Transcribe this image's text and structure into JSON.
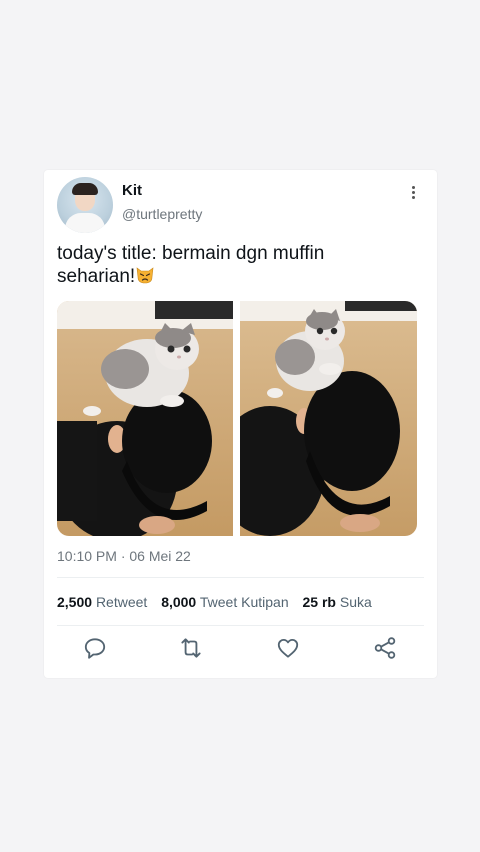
{
  "tweet": {
    "author_name": "Kit",
    "handle": "@turtlepretty",
    "text": "today's title: bermain dgn muffin seharian!",
    "timestamp": "10:10 PM · 06 Mei 22"
  },
  "stats": {
    "retweets_count": "2,500",
    "retweets_label": "Retweet",
    "quotes_count": "8,000",
    "quotes_label": "Tweet Kutipan",
    "likes_count": "25 rb",
    "likes_label": "Suka"
  },
  "icons": [
    "more-vertical-icon",
    "reply-icon",
    "retweet-icon",
    "like-icon",
    "share-icon",
    "pouting-cat-emoji"
  ],
  "colors": {
    "icon": "#536471",
    "secondary_text": "#6e767d",
    "background": "#f4f4f6"
  }
}
